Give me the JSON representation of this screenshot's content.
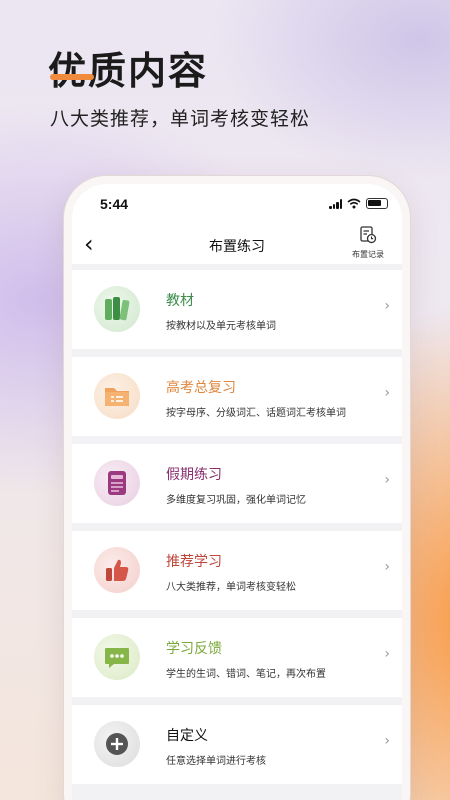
{
  "promo": {
    "headline": "优质内容",
    "subline": "八大类推荐，单词考核变轻松"
  },
  "status_bar": {
    "time": "5:44"
  },
  "nav": {
    "title": "布置练习",
    "history_label": "布置记录"
  },
  "items": [
    {
      "title": "教材",
      "desc": "按教材以及单元考核单词",
      "color": "#3c8c4c",
      "icon": "books-icon"
    },
    {
      "title": "高考总复习",
      "desc": "按字母序、分级词汇、话题词汇考核单词",
      "color": "#e0873e",
      "icon": "folder-icon"
    },
    {
      "title": "假期练习",
      "desc": "多维度复习巩固，强化单词记忆",
      "color": "#8a2e6e",
      "icon": "document-icon"
    },
    {
      "title": "推荐学习",
      "desc": "八大类推荐，单词考核变轻松",
      "color": "#c0453a",
      "icon": "thumbs-up-icon"
    },
    {
      "title": "学习反馈",
      "desc": "学生的生词、错词、笔记，再次布置",
      "color": "#7aa83c",
      "icon": "chat-bubble-icon"
    },
    {
      "title": "自定义",
      "desc": "任意选择单词进行考核",
      "color": "#111111",
      "icon": "plus-circle-icon"
    }
  ],
  "colors": {
    "accent_orange": "#f08a3c"
  }
}
